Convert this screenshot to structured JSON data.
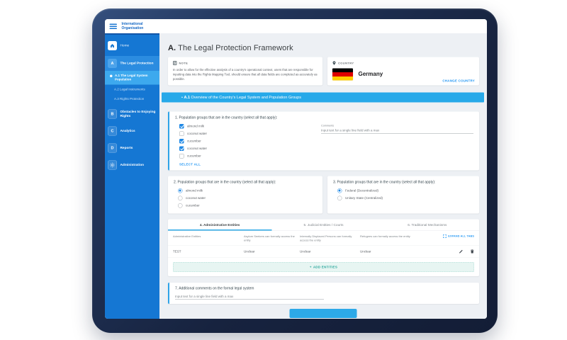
{
  "topbar": {
    "logo_line1": "International",
    "logo_line2": "Organisation"
  },
  "sidebar": {
    "home": "Home",
    "a_letter": "A",
    "a_label": "The Legal Protection",
    "a1": "A.1 The Legal System Population",
    "a2": "A.2 Legal Instruments",
    "a3": "A.3 Rights Protection",
    "b_letter": "B",
    "b_label": "Obstacles to Enjoying Rights",
    "c_letter": "C",
    "c_label": "Analytics",
    "d_letter": "D",
    "d_label": "Reports",
    "admin_label": "Administration"
  },
  "page": {
    "prefix": "A.",
    "title": "The Legal Protection Framework"
  },
  "note": {
    "label": "NOTE",
    "body": "In order to allow for the effective analysis of a country's operational context, users that are responsible for inputting data into the Rights Mapping Tool, should ensure that all data fields are completed as accurately as possible."
  },
  "country": {
    "label": "COUNTRY",
    "name": "Germany",
    "change": "CHANGE COUNTRY"
  },
  "section_bar": {
    "bullet": "•",
    "code": "A.1",
    "title": "Overview of the Country's Legal System and Population Groups"
  },
  "q1": {
    "label": "1. Population groups that are in the country (select all that apply):",
    "options": [
      {
        "label": "almond milk",
        "checked": true
      },
      {
        "label": "coconut water",
        "checked": false
      },
      {
        "label": "cucumber",
        "checked": true
      },
      {
        "label": "coconut water",
        "checked": true
      },
      {
        "label": "cucumber",
        "checked": false
      }
    ],
    "select_all": "SELECT ALL",
    "comments_label": "Comments",
    "placeholder": "Input text for a single line field with a max"
  },
  "q2": {
    "label": "2. Population groups that are in the country (select all that apply):",
    "options": [
      {
        "label": "almond milk",
        "selected": true
      },
      {
        "label": "coconut water",
        "selected": false
      },
      {
        "label": "cucumber",
        "selected": false
      }
    ]
  },
  "q3": {
    "label": "3. Population groups that are in the country (select all that apply):",
    "options": [
      {
        "label": "Federal (Decentralized)",
        "selected": true
      },
      {
        "label": "Unitary State (Centralized)",
        "selected": false
      }
    ]
  },
  "tabs": {
    "tab4": "4. Administrative Entities",
    "tab5": "5. Judicial Entities / Courts",
    "tab6": "6. Traditional Mechanisms"
  },
  "table": {
    "headers": [
      "Administrative Entities",
      "Asylum Seekers can formally access the entity",
      "Internally Displaced Persons can formally access the entity",
      "Refugees can formally access the entity"
    ],
    "expand": "EXPAND ALL TABS",
    "row": [
      "TEST",
      "Unclear",
      "Unclear",
      "Unclear"
    ],
    "add_plus": "+",
    "add": "ADD ENTITIES"
  },
  "q7": {
    "label": "7. Additional comments on the formal legal system",
    "placeholder": "Input text for a single line field with a max"
  },
  "colors": {
    "sidebar": "#1577d3",
    "section_bar": "#27a9e9",
    "link": "#2196f3",
    "teal": "#26a69a",
    "frame": "#17233f"
  }
}
